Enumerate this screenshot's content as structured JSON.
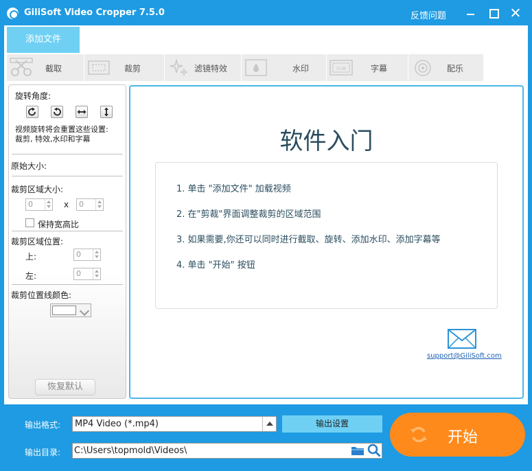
{
  "titlebar": {
    "title": "GiliSoft Video Cropper 7.5.0",
    "feedback": "反馈问题"
  },
  "toolbar": {
    "add_file": "添加文件"
  },
  "tabs": [
    {
      "label": "截取",
      "icon": "film-cut-icon"
    },
    {
      "label": "裁剪",
      "icon": "crop-frame-icon"
    },
    {
      "label": "滤镜特效",
      "icon": "sparkle-icon"
    },
    {
      "label": "水印",
      "icon": "watermark-drop-icon"
    },
    {
      "label": "字幕",
      "icon": "subtitle-icon"
    },
    {
      "label": "配乐",
      "icon": "music-icon"
    }
  ],
  "left_panel": {
    "rotate_label": "旋转角度:",
    "rotate_note_1": "视频旋转将会重置这些设置:",
    "rotate_note_2": "裁剪, 特效,水印和字幕",
    "original_size_label": "原始大小:",
    "crop_size_label": "裁剪区域大小:",
    "width_value": "0",
    "times_sign": "x",
    "height_value": "0",
    "keep_ratio_label": "保持宽高比",
    "crop_position_label": "裁剪区域位置:",
    "top_label": "上:",
    "top_value": "0",
    "left_label": "左:",
    "left_value": "0",
    "line_color_label": "裁剪位置线颜色:",
    "line_color": "#ffffff",
    "reset_button": "恢复默认"
  },
  "guide": {
    "title": "软件入门",
    "steps": [
      "1. 单击 \"添加文件\" 加载视频",
      "2. 在\"剪裁\"界面调整裁剪的区域范围",
      "3. 如果需要,你还可以同时进行截取、旋转、添加水印、添加字幕等",
      "4. 单击 \"开始\" 按钮"
    ],
    "support_email": "support@GiliSoft.com"
  },
  "bottom": {
    "format_label": "输出格式:",
    "format_value": "MP4 Video (*.mp4)",
    "output_settings": "输出设置",
    "dir_label": "输出目录:",
    "dir_value": "C:\\Users\\topmold\\Videos\\",
    "start_label": "开始"
  },
  "colors": {
    "titlebar": "#1e9be2",
    "accent_light": "#6fd0f4",
    "start_button": "#ff8a1c",
    "panel_border": "#4db6e8"
  }
}
